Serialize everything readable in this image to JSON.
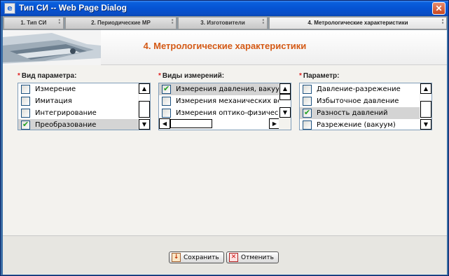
{
  "window": {
    "title": "Тип СИ -- Web Page Dialog",
    "close_glyph": "✕"
  },
  "tabs": [
    {
      "label": "1. Тип СИ",
      "active": false
    },
    {
      "label": "2. Периодические МР",
      "active": false
    },
    {
      "label": "3. Изготовители",
      "active": false
    },
    {
      "label": "4. Метрологические характеристики",
      "active": true
    }
  ],
  "banner": {
    "heading": "4. Метрологические характеристики"
  },
  "panels": [
    {
      "label": "Вид параметра:",
      "required_mark": "*",
      "items": [
        {
          "text": "Измерение",
          "checked": false,
          "selected": false
        },
        {
          "text": "Имитация",
          "checked": false,
          "selected": false
        },
        {
          "text": "Интегрирование",
          "checked": false,
          "selected": false
        },
        {
          "text": "Преобразование",
          "checked": true,
          "selected": true
        }
      ]
    },
    {
      "label": "Виды измерений:",
      "required_mark": "*",
      "items": [
        {
          "text": "Измерения давления, вакуума (К",
          "checked": true,
          "selected": true
        },
        {
          "text": "Измерения механических величи",
          "checked": false,
          "selected": false
        },
        {
          "text": "Измерения оптико-физических в",
          "checked": false,
          "selected": false
        }
      ]
    },
    {
      "label": "Параметр:",
      "required_mark": "*",
      "items": [
        {
          "text": "Давление-разрежение",
          "checked": false,
          "selected": false
        },
        {
          "text": "Избыточное давление",
          "checked": false,
          "selected": false
        },
        {
          "text": "Разность давлений",
          "checked": true,
          "selected": true
        },
        {
          "text": "Разрежение (вакуум)",
          "checked": false,
          "selected": false
        }
      ]
    }
  ],
  "buttons": {
    "save": {
      "label": "Сохранить",
      "icon": "save-icon"
    },
    "cancel": {
      "label": "Отменить",
      "icon": "cancel-icon"
    }
  },
  "icons": {
    "scroll_up": "▲",
    "scroll_down": "▼",
    "scroll_left": "◀",
    "scroll_right": "▶"
  },
  "colors": {
    "heading": "#d45a16",
    "required": "#e02020",
    "titlebar": "#0553d3"
  }
}
